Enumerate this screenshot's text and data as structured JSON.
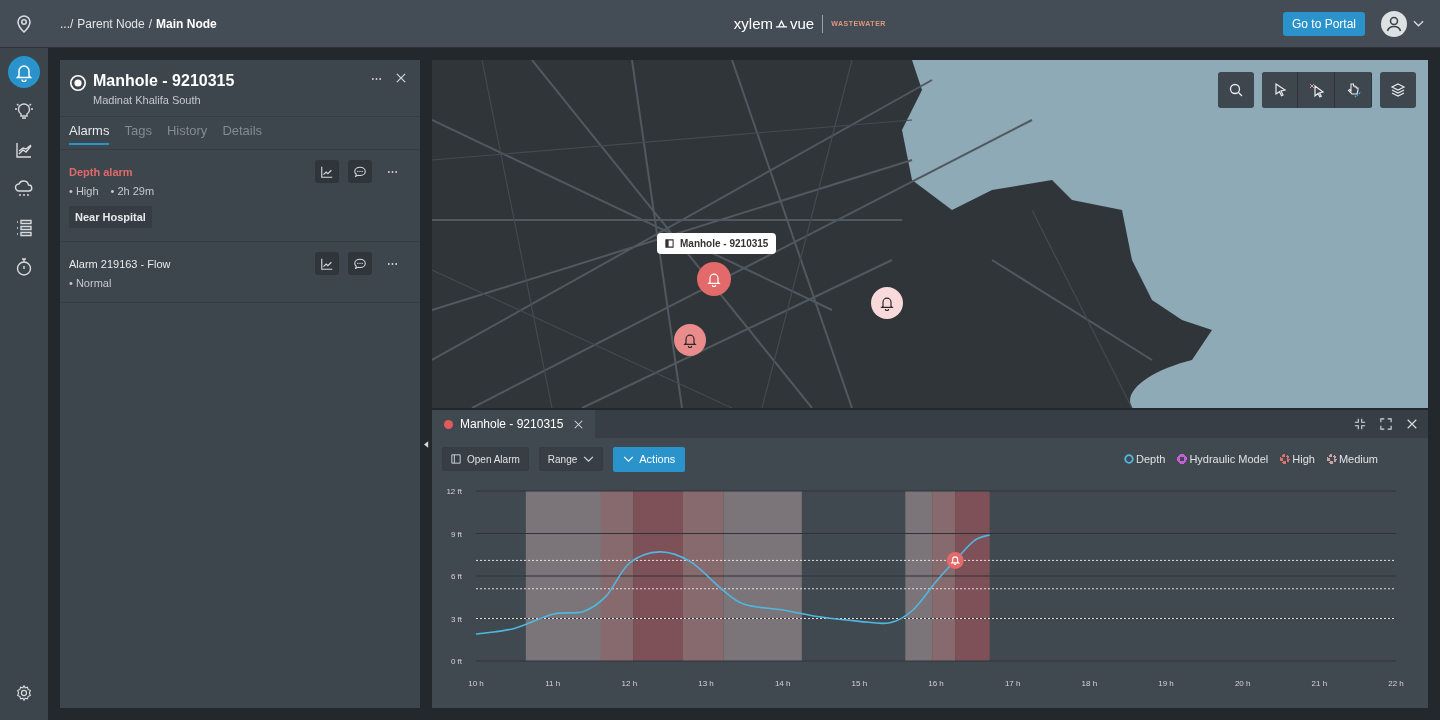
{
  "topbar": {
    "breadcrumb": [
      {
        "label": ".../",
        "current": false
      },
      {
        "label": "Parent Node",
        "current": false
      },
      {
        "label": "/",
        "current": false
      },
      {
        "label": "Main Node",
        "current": true
      }
    ],
    "logo": {
      "brand": "xylem",
      "product": "vue",
      "division": "WASTEWATER"
    },
    "portal_button": "Go to Portal"
  },
  "rail": [
    {
      "kind": "bell",
      "selected": true
    },
    {
      "kind": "bulb",
      "selected": false
    },
    {
      "kind": "trend",
      "selected": false
    },
    {
      "kind": "rain",
      "selected": false
    },
    {
      "kind": "list",
      "selected": false
    },
    {
      "kind": "timer",
      "selected": false
    }
  ],
  "panel": {
    "title": "Manhole - 9210315",
    "subtitle": "Madinat Khalifa South",
    "tabs": [
      {
        "label": "Alarms",
        "selected": true
      },
      {
        "label": "Tags",
        "selected": false
      },
      {
        "label": "History",
        "selected": false
      },
      {
        "label": "Details",
        "selected": false
      }
    ],
    "alarms": [
      {
        "title": "Depth alarm",
        "active": true,
        "meta": [
          "• High",
          "• 2h 29m"
        ],
        "chip": "Near Hospital"
      },
      {
        "title": "Alarm 219163 - Flow",
        "active": false,
        "meta": [
          "• Normal"
        ]
      }
    ]
  },
  "map": {
    "tooltip": "Manhole - 9210315",
    "markers": [
      {
        "color": "#e36a6a"
      },
      {
        "color": "#ea8c8c"
      },
      {
        "color": "#f9d9d9"
      }
    ]
  },
  "detail": {
    "tab": {
      "title": "Manhole - 9210315",
      "color": "#e35a5a"
    },
    "toolbar": {
      "open_alarm": "Open Alarm",
      "range": "Range",
      "actions": "Actions"
    },
    "legend": [
      {
        "label": "Hydraulic Model",
        "color": "#c65fd6",
        "kind": "solid"
      },
      {
        "label": "High",
        "color": "#d9736b",
        "kind": "dotted"
      },
      {
        "label": "Medium",
        "color": "#c8a2a2",
        "kind": "dotted"
      }
    ],
    "chart_data": {
      "type": "line",
      "x": [
        10,
        10.5,
        11,
        11.4,
        11.7,
        12,
        12.4,
        12.8,
        13.2,
        13.5,
        14,
        14.5,
        15,
        15.4,
        15.7,
        16,
        16.25,
        16.5,
        16.7
      ],
      "series": [
        {
          "name": "Depth",
          "color": "#4fb8e0",
          "values": [
            1.9,
            2.3,
            3.3,
            3.5,
            4.6,
            6.9,
            7.7,
            7.0,
            5.1,
            4.0,
            3.6,
            3.1,
            2.8,
            2.7,
            3.6,
            5.6,
            7.1,
            8.5,
            8.9
          ]
        }
      ],
      "xlim": [
        10,
        22
      ],
      "ylim": [
        0,
        12
      ],
      "grid": true,
      "xticks": [
        {
          "value": 10,
          "label": "10 h"
        },
        {
          "value": 11,
          "label": "11 h"
        },
        {
          "value": 12,
          "label": "12 h"
        },
        {
          "value": 13,
          "label": "13 h"
        },
        {
          "value": 14,
          "label": "14 h"
        },
        {
          "value": 15,
          "label": "15 h"
        },
        {
          "value": 16,
          "label": "16 h"
        },
        {
          "value": 17,
          "label": "17 h"
        },
        {
          "value": 18,
          "label": "18 h"
        },
        {
          "value": 19,
          "label": "19 h"
        },
        {
          "value": 20,
          "label": "20 h"
        },
        {
          "value": 21,
          "label": "21 h"
        },
        {
          "value": 22,
          "label": "22 h"
        }
      ],
      "yticks": [
        {
          "value": 0,
          "label": "0 ft"
        },
        {
          "value": 3,
          "label": "3 ft"
        },
        {
          "value": 6,
          "label": "6 ft"
        },
        {
          "value": 9,
          "label": "9 ft"
        },
        {
          "value": 12,
          "label": "12 ft"
        }
      ],
      "bands": [
        {
          "axis": "x",
          "from": 10.65,
          "to": 11.63,
          "color": "#7b7579"
        },
        {
          "axis": "x",
          "from": 11.63,
          "to": 12.05,
          "color": "#876a6d"
        },
        {
          "axis": "x",
          "from": 12.05,
          "to": 12.7,
          "color": "#7d5157"
        },
        {
          "axis": "x",
          "from": 12.7,
          "to": 13.23,
          "color": "#876a6d"
        },
        {
          "axis": "x",
          "from": 13.23,
          "to": 14.25,
          "color": "#7b7579"
        },
        {
          "axis": "x",
          "from": 15.6,
          "to": 15.95,
          "color": "#7b7579"
        },
        {
          "axis": "x",
          "from": 15.95,
          "to": 16.25,
          "color": "#876a6d"
        },
        {
          "axis": "x",
          "from": 16.25,
          "to": 16.7,
          "color": "#7d5157"
        }
      ],
      "ref_lines": [
        {
          "axis": "y",
          "value": 7.1
        },
        {
          "axis": "y",
          "value": 5.1
        },
        {
          "axis": "y",
          "value": 3.0
        }
      ]
    }
  }
}
